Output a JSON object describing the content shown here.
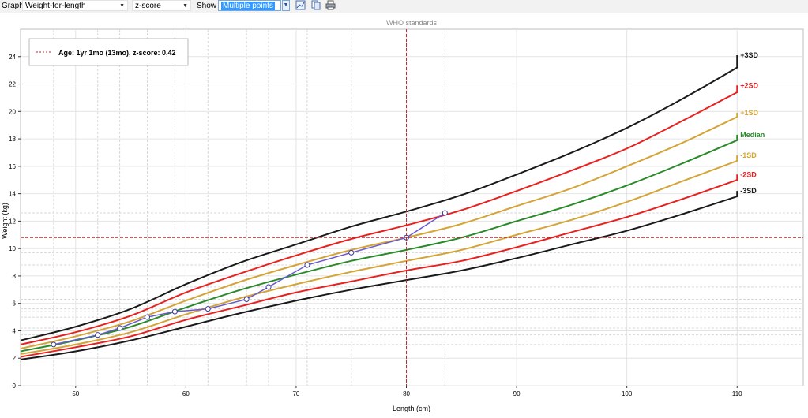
{
  "toolbar": {
    "graph_label": "Graph",
    "graph_value": "Weight-for-length",
    "scale_value": "z-score",
    "show_label": "Show",
    "show_value": "Multiple points"
  },
  "chart_data": {
    "type": "line",
    "title": "WHO standards",
    "xlabel": "Length (cm)",
    "ylabel": "Weight (kg)",
    "xlim": [
      45,
      116
    ],
    "ylim": [
      0,
      26
    ],
    "x_ticks": [
      50,
      60,
      70,
      80,
      90,
      100,
      110
    ],
    "y_ticks": [
      0,
      2,
      4,
      6,
      8,
      10,
      12,
      14,
      16,
      18,
      20,
      22,
      24
    ],
    "grid": true,
    "series": [
      {
        "name": "+3SD",
        "color": "#1a1a1a",
        "points": [
          [
            45,
            3.3
          ],
          [
            50,
            4.3
          ],
          [
            55,
            5.6
          ],
          [
            60,
            7.4
          ],
          [
            65,
            9.0
          ],
          [
            70,
            10.3
          ],
          [
            75,
            11.6
          ],
          [
            80,
            12.7
          ],
          [
            85,
            13.9
          ],
          [
            90,
            15.4
          ],
          [
            95,
            17.0
          ],
          [
            100,
            18.8
          ],
          [
            105,
            20.9
          ],
          [
            110,
            23.2
          ]
        ],
        "end_value": 24.1
      },
      {
        "name": "+2SD",
        "color": "#e8211f",
        "points": [
          [
            45,
            3.0
          ],
          [
            50,
            3.9
          ],
          [
            55,
            5.1
          ],
          [
            60,
            6.8
          ],
          [
            65,
            8.2
          ],
          [
            70,
            9.5
          ],
          [
            75,
            10.7
          ],
          [
            80,
            11.7
          ],
          [
            85,
            12.8
          ],
          [
            90,
            14.2
          ],
          [
            95,
            15.7
          ],
          [
            100,
            17.3
          ],
          [
            105,
            19.3
          ],
          [
            110,
            21.4
          ]
        ],
        "end_value": 21.9
      },
      {
        "name": "+1SD",
        "color": "#d4a437",
        "points": [
          [
            45,
            2.7
          ],
          [
            50,
            3.6
          ],
          [
            55,
            4.7
          ],
          [
            60,
            6.2
          ],
          [
            65,
            7.6
          ],
          [
            70,
            8.8
          ],
          [
            75,
            9.9
          ],
          [
            80,
            10.8
          ],
          [
            85,
            11.8
          ],
          [
            90,
            13.1
          ],
          [
            95,
            14.4
          ],
          [
            100,
            16.0
          ],
          [
            105,
            17.7
          ],
          [
            110,
            19.6
          ]
        ],
        "end_value": 19.9
      },
      {
        "name": "Median",
        "color": "#2a8a2a",
        "points": [
          [
            45,
            2.5
          ],
          [
            50,
            3.3
          ],
          [
            55,
            4.3
          ],
          [
            60,
            5.7
          ],
          [
            65,
            7.0
          ],
          [
            70,
            8.1
          ],
          [
            75,
            9.1
          ],
          [
            80,
            9.9
          ],
          [
            85,
            10.8
          ],
          [
            90,
            12.0
          ],
          [
            95,
            13.2
          ],
          [
            100,
            14.6
          ],
          [
            105,
            16.2
          ],
          [
            110,
            17.9
          ]
        ],
        "end_value": 18.3
      },
      {
        "name": "-1SD",
        "color": "#d4a437",
        "points": [
          [
            45,
            2.3
          ],
          [
            50,
            3.0
          ],
          [
            55,
            3.9
          ],
          [
            60,
            5.2
          ],
          [
            65,
            6.4
          ],
          [
            70,
            7.4
          ],
          [
            75,
            8.3
          ],
          [
            80,
            9.1
          ],
          [
            85,
            9.9
          ],
          [
            90,
            11.0
          ],
          [
            95,
            12.1
          ],
          [
            100,
            13.4
          ],
          [
            105,
            14.9
          ],
          [
            110,
            16.4
          ]
        ],
        "end_value": 16.8
      },
      {
        "name": "-2SD",
        "color": "#e8211f",
        "points": [
          [
            45,
            2.1
          ],
          [
            50,
            2.8
          ],
          [
            55,
            3.6
          ],
          [
            60,
            4.8
          ],
          [
            65,
            5.8
          ],
          [
            70,
            6.8
          ],
          [
            75,
            7.6
          ],
          [
            80,
            8.4
          ],
          [
            85,
            9.1
          ],
          [
            90,
            10.1
          ],
          [
            95,
            11.2
          ],
          [
            100,
            12.3
          ],
          [
            105,
            13.6
          ],
          [
            110,
            15.0
          ]
        ],
        "end_value": 15.4
      },
      {
        "name": "-3SD",
        "color": "#1a1a1a",
        "points": [
          [
            45,
            1.9
          ],
          [
            50,
            2.5
          ],
          [
            55,
            3.3
          ],
          [
            60,
            4.3
          ],
          [
            65,
            5.3
          ],
          [
            70,
            6.2
          ],
          [
            75,
            7.0
          ],
          [
            80,
            7.7
          ],
          [
            85,
            8.4
          ],
          [
            90,
            9.3
          ],
          [
            95,
            10.3
          ],
          [
            100,
            11.3
          ],
          [
            105,
            12.5
          ],
          [
            110,
            13.8
          ]
        ],
        "end_value": 14.2
      }
    ],
    "patient_points": {
      "color": "#6a5acd",
      "points": [
        [
          48,
          3.0
        ],
        [
          52,
          3.7
        ],
        [
          54,
          4.2
        ],
        [
          56.5,
          5.0
        ],
        [
          59,
          5.4
        ],
        [
          62,
          5.6
        ],
        [
          65.5,
          6.3
        ],
        [
          67.5,
          7.2
        ],
        [
          71,
          8.8
        ],
        [
          75,
          9.7
        ],
        [
          80,
          10.8
        ],
        [
          83.5,
          12.6
        ]
      ]
    },
    "cursor": {
      "x": 80,
      "y": 10.8,
      "color": "#c0272d"
    },
    "legend": {
      "text": "Age: 1yr 1mo (13mo), z-score: 0,42",
      "placement": "top-left"
    },
    "crosshair_y_values": [
      12.6,
      9.7,
      8.8,
      7.2,
      6.3,
      5.6,
      5.4,
      5.0,
      4.2,
      3.7,
      3.0
    ],
    "crosshair_x_values": [
      48,
      52,
      54,
      56.5,
      59,
      62,
      65.5,
      67.5,
      71,
      75,
      83.5
    ]
  }
}
